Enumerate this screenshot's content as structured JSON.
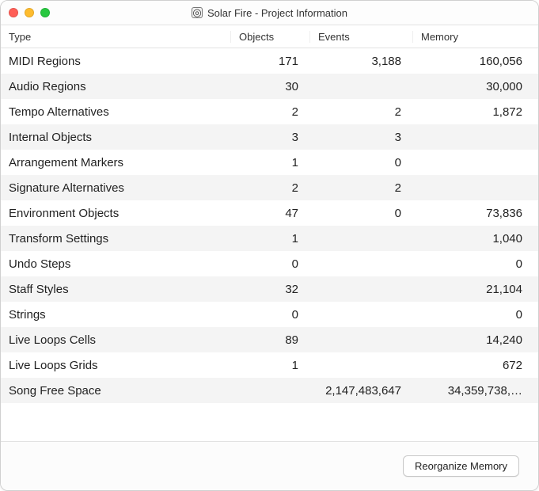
{
  "window": {
    "title": "Solar Fire - Project Information"
  },
  "columns": {
    "type": "Type",
    "objects": "Objects",
    "events": "Events",
    "memory": "Memory"
  },
  "rows": [
    {
      "type": "MIDI Regions",
      "objects": "171",
      "events": "3,188",
      "memory": "160,056"
    },
    {
      "type": "Audio Regions",
      "objects": "30",
      "events": "",
      "memory": "30,000"
    },
    {
      "type": "Tempo Alternatives",
      "objects": "2",
      "events": "2",
      "memory": "1,872"
    },
    {
      "type": "Internal Objects",
      "objects": "3",
      "events": "3",
      "memory": ""
    },
    {
      "type": "Arrangement Markers",
      "objects": "1",
      "events": "0",
      "memory": ""
    },
    {
      "type": "Signature Alternatives",
      "objects": "2",
      "events": "2",
      "memory": ""
    },
    {
      "type": "Environment Objects",
      "objects": "47",
      "events": "0",
      "memory": "73,836"
    },
    {
      "type": "Transform Settings",
      "objects": "1",
      "events": "",
      "memory": "1,040"
    },
    {
      "type": "Undo Steps",
      "objects": "0",
      "events": "",
      "memory": "0"
    },
    {
      "type": "Staff Styles",
      "objects": "32",
      "events": "",
      "memory": "21,104"
    },
    {
      "type": "Strings",
      "objects": "0",
      "events": "",
      "memory": "0"
    },
    {
      "type": "Live Loops Cells",
      "objects": "89",
      "events": "",
      "memory": "14,240"
    },
    {
      "type": "Live Loops Grids",
      "objects": "1",
      "events": "",
      "memory": "672"
    },
    {
      "type": "Song Free Space",
      "objects": "",
      "events": "2,147,483,647",
      "memory": "34,359,738,…"
    }
  ],
  "footer": {
    "reorganize_label": "Reorganize Memory"
  }
}
